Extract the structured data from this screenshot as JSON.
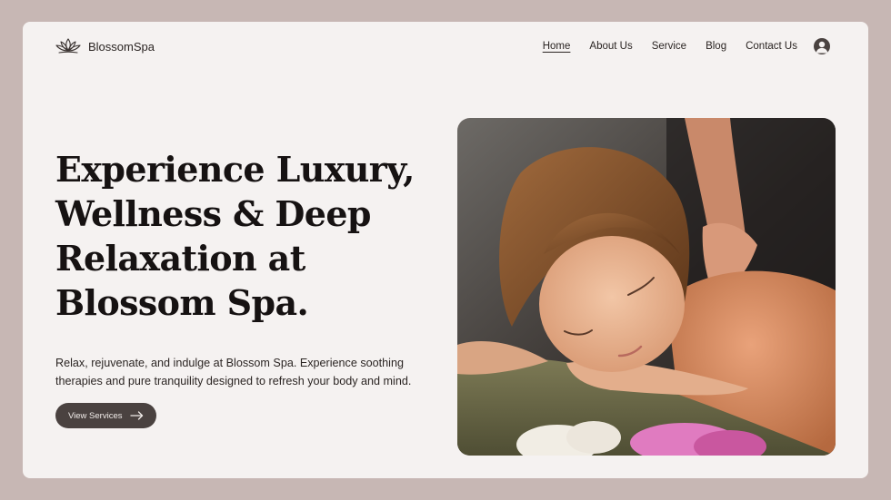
{
  "brand": {
    "name": "BlossomSpa",
    "logo_icon": "lotus-icon"
  },
  "nav": {
    "items": [
      {
        "label": "Home",
        "active": true
      },
      {
        "label": "About Us",
        "active": false
      },
      {
        "label": "Service",
        "active": false
      },
      {
        "label": "Blog",
        "active": false
      },
      {
        "label": "Contact Us",
        "active": false
      }
    ],
    "profile_icon": "user-avatar-icon"
  },
  "hero": {
    "title": "Experience Luxury, Wellness & Deep Relaxation at Blossom Spa.",
    "description": "Relax, rejuvenate, and indulge at Blossom Spa. Experience soothing therapies and pure tranquility designed to refresh your body and mind.",
    "cta_label": "View Services",
    "cta_icon": "arrow-right-icon",
    "image": "woman-receiving-back-massage-photo"
  },
  "colors": {
    "background": "#c7b7b4",
    "card": "#f5f2f1",
    "text": "#161212",
    "button": "#4a4240"
  }
}
